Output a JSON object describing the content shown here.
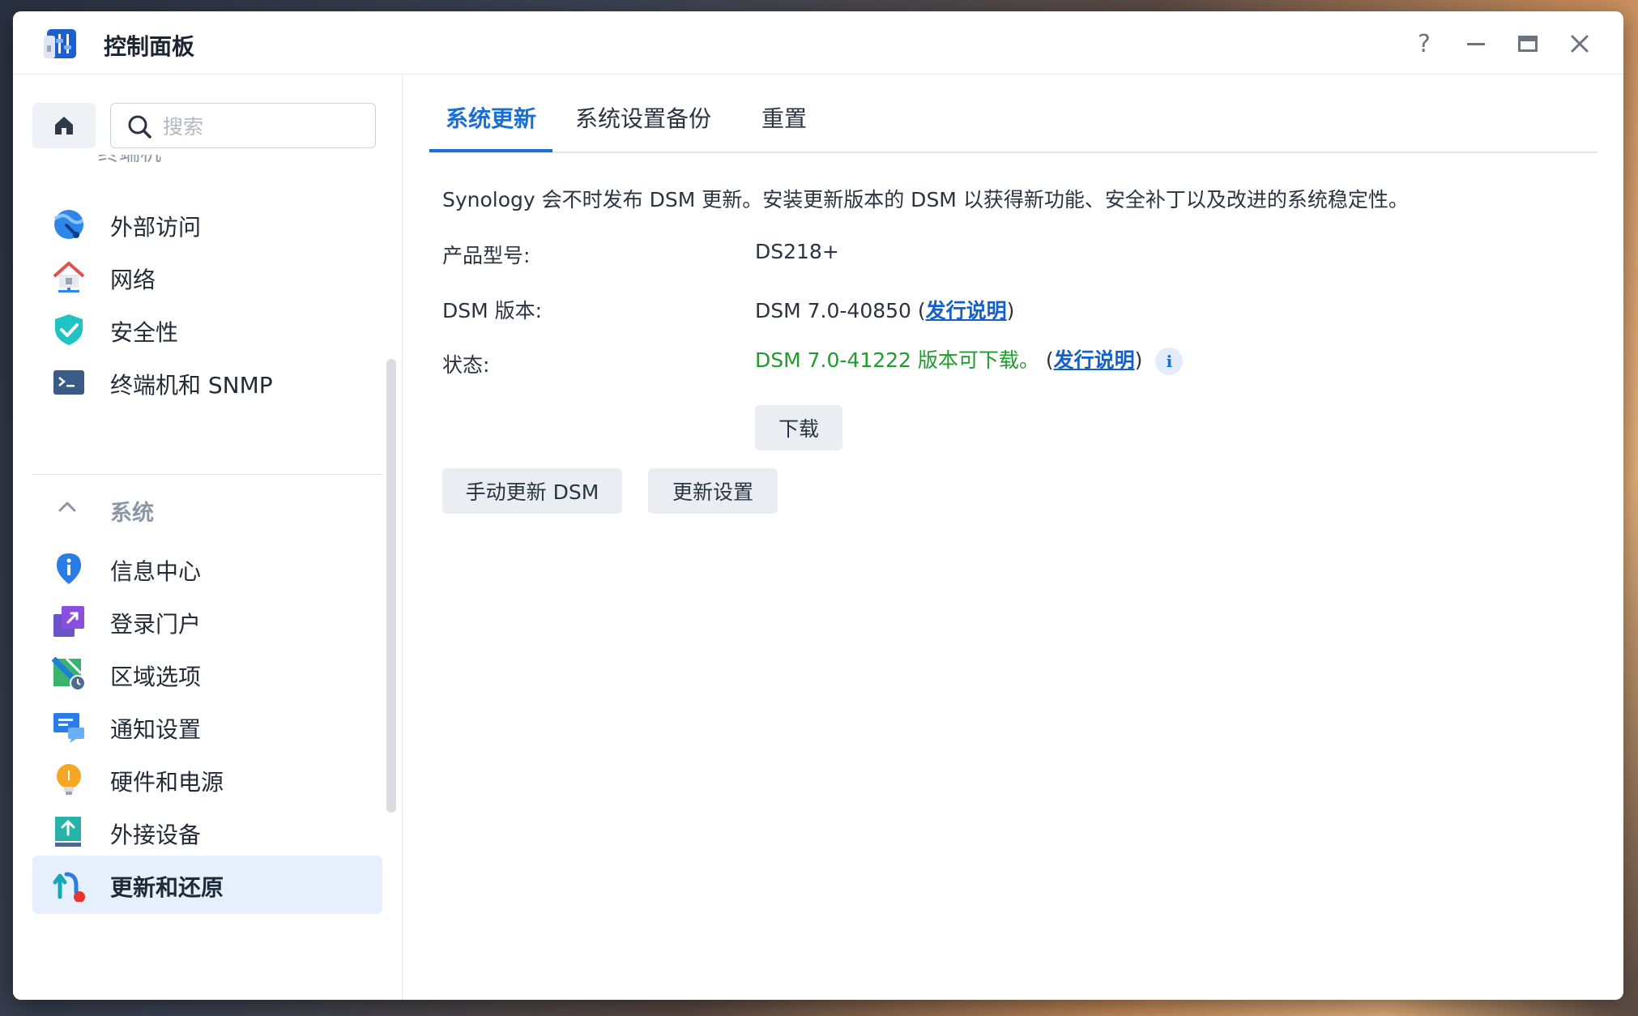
{
  "window": {
    "title": "控制面板",
    "controls": {
      "help": "?"
    }
  },
  "sidebar": {
    "search_placeholder": "搜索",
    "partial_item": "终端机",
    "items_top": [
      {
        "label": "外部访问",
        "icon": "external-access-icon"
      },
      {
        "label": "网络",
        "icon": "network-house-icon"
      },
      {
        "label": "安全性",
        "icon": "shield-check-icon"
      },
      {
        "label": "终端机和 SNMP",
        "icon": "terminal-icon"
      }
    ],
    "section": {
      "label": "系统",
      "icon": "chevron-up-icon"
    },
    "items_system": [
      {
        "label": "信息中心",
        "icon": "info-pin-icon"
      },
      {
        "label": "登录门户",
        "icon": "login-portal-icon"
      },
      {
        "label": "区域选项",
        "icon": "regional-map-icon"
      },
      {
        "label": "通知设置",
        "icon": "notification-chat-icon"
      },
      {
        "label": "硬件和电源",
        "icon": "lightbulb-icon"
      },
      {
        "label": "外接设备",
        "icon": "external-device-icon"
      },
      {
        "label": "更新和还原",
        "icon": "update-restore-icon"
      }
    ]
  },
  "tabs": [
    {
      "label": "系统更新"
    },
    {
      "label": "系统设置备份"
    },
    {
      "label": "重置"
    }
  ],
  "update": {
    "description": "Synology 会不时发布 DSM 更新。安装更新版本的 DSM 以获得新功能、安全补丁以及改进的系统稳定性。",
    "model_label": "产品型号:",
    "model_value": "DS218+",
    "version_label": "DSM 版本:",
    "version_value": "DSM 7.0-40850",
    "release_notes": "发行说明",
    "status_label": "状态:",
    "status_value": "DSM 7.0-41222 版本可下载。",
    "info_glyph": "i",
    "download_button": "下载",
    "manual_update_button": "手动更新 DSM",
    "update_settings_button": "更新设置"
  },
  "colors": {
    "accent": "#1a6fd6",
    "status_green": "#1f9b2d",
    "active_bg": "#e6effc"
  }
}
